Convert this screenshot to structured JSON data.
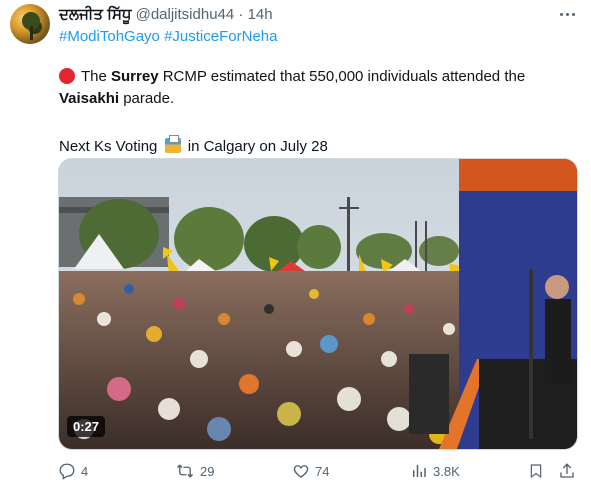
{
  "author": {
    "display_name": "ਦਲਜੀਤ ਸਿੱਧੂ",
    "handle": "@daljitsidhu44",
    "separator": "·",
    "time": "14h"
  },
  "hashtags": [
    "#ModiTohGayo",
    "#JusticeForNeha"
  ],
  "text": {
    "line1_pre": "The ",
    "line1_bold1": "Surrey",
    "line1_mid": " RCMP estimated that 550,000 individuals attended the",
    "line2_bold": "Vaisakhi",
    "line2_post": " parade.",
    "line3_pre": "Next Ks Voting",
    "line3_post": " in Calgary on July 28"
  },
  "video": {
    "duration": "0:27"
  },
  "actions": {
    "replies": "4",
    "retweets": "29",
    "likes": "74",
    "views": "3.8K"
  },
  "icons": {
    "avatar": "profile-photo",
    "more": "more-dots-icon",
    "reply": "reply-icon",
    "retweet": "retweet-icon",
    "like": "heart-icon",
    "views": "views-icon",
    "bookmark": "bookmark-icon",
    "share": "share-icon"
  },
  "colors": {
    "link": "#1d9bf0",
    "muted": "#536471",
    "text": "#0f1419"
  }
}
